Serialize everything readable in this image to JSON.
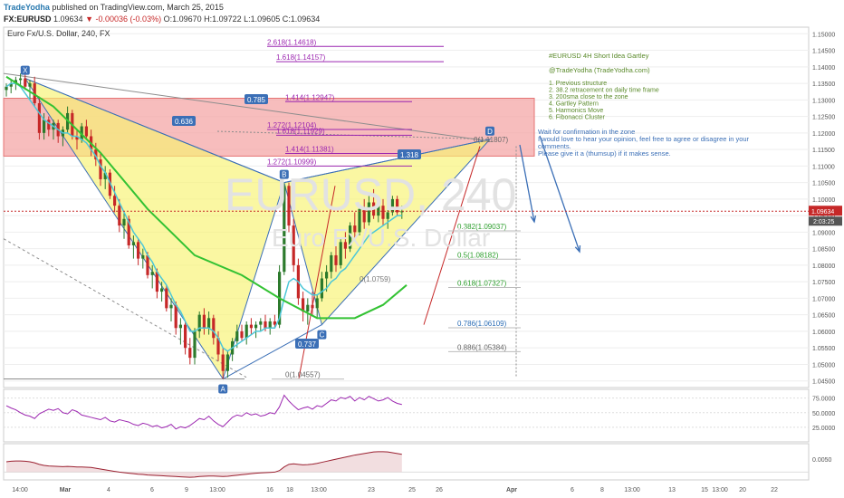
{
  "header": {
    "author": "TradeYodha",
    "published": "published on TradingView.com, March 25, 2015",
    "symbol": "FX:EURUSD",
    "last": "1.09634",
    "change": "-0.00036 (-0.03%)",
    "ohlc": "O:1.09670 H:1.09722 L:1.09605 C:1.09634"
  },
  "instrument_title": "Euro Fx/U.S. Dollar, 240, FX",
  "watermark": {
    "symbol": "EURUSD, 240",
    "name": "Euro Fx/U.S. Dollar"
  },
  "notes": {
    "title": "#EURUSD 4H Short Idea Gartley",
    "handle": "@TradeYodha (TradeYodha.com)",
    "list": [
      "1. Previous structure",
      "2. 38.2 retracement on daily time frame",
      "3. 200sma close to the zone",
      "4. Gartley Pattern",
      "5. Harmonics Move",
      "6. Fibonacci Cluster"
    ],
    "confirm": [
      "Wait for confirmation in the zone",
      "I would love to hear your opinion, feel free to agree or disagree in your",
      "comments.",
      "Please give it a (thumsup) if it makes sense."
    ]
  },
  "colors": {
    "up": "#2c7a2c",
    "down": "#c62828",
    "zone": "#f4a7a7",
    "pattern": "#f8f270",
    "ema": "#4cc7d8",
    "sma": "#33c233",
    "osc1": "#9c27b0",
    "osc2": "#9a2030",
    "arrow": "#3b6fb6",
    "label_bg": "#3b6fb6"
  },
  "chart_data": [
    {
      "type": "candlestick",
      "title": "Euro Fx/U.S. Dollar, 240, FX",
      "x_ticks": [
        "14:00",
        "Mar",
        "4",
        "6",
        "9",
        "13:00",
        "16",
        "18",
        "13:00",
        "23",
        "25",
        "26",
        "Apr",
        "6",
        "8",
        "13:00",
        "13",
        "15",
        "13:00",
        "20",
        "22"
      ],
      "y_ticks": [
        "1.04500",
        "1.05000",
        "1.05500",
        "1.06000",
        "1.06500",
        "1.07000",
        "1.07500",
        "1.08000",
        "1.08500",
        "1.09000",
        "1.09500",
        "1.10000",
        "1.10500",
        "1.11000",
        "1.11500",
        "1.12000",
        "1.12500",
        "1.13000",
        "1.13500",
        "1.14000",
        "1.14500",
        "1.15000"
      ],
      "ylim": [
        1.043,
        1.152
      ],
      "last_price_label": "1.09634",
      "countdown_label": "2:03:25",
      "ohlc": [
        [
          1.133,
          1.135,
          1.131,
          1.134
        ],
        [
          1.134,
          1.136,
          1.132,
          1.135
        ],
        [
          1.135,
          1.137,
          1.133,
          1.136
        ],
        [
          1.136,
          1.138,
          1.134,
          1.1365
        ],
        [
          1.1365,
          1.138,
          1.133,
          1.134
        ],
        [
          1.134,
          1.136,
          1.13,
          1.135
        ],
        [
          1.135,
          1.137,
          1.128,
          1.129
        ],
        [
          1.129,
          1.131,
          1.118,
          1.12
        ],
        [
          1.12,
          1.126,
          1.118,
          1.124
        ],
        [
          1.124,
          1.125,
          1.119,
          1.121
        ],
        [
          1.121,
          1.124,
          1.118,
          1.123
        ],
        [
          1.123,
          1.124,
          1.117,
          1.119
        ],
        [
          1.119,
          1.122,
          1.116,
          1.121
        ],
        [
          1.121,
          1.128,
          1.12,
          1.126
        ],
        [
          1.126,
          1.127,
          1.118,
          1.119
        ],
        [
          1.119,
          1.121,
          1.115,
          1.118
        ],
        [
          1.118,
          1.123,
          1.117,
          1.122
        ],
        [
          1.122,
          1.124,
          1.118,
          1.119
        ],
        [
          1.119,
          1.121,
          1.113,
          1.115
        ],
        [
          1.115,
          1.117,
          1.11,
          1.112
        ],
        [
          1.112,
          1.114,
          1.104,
          1.106
        ],
        [
          1.106,
          1.11,
          1.103,
          1.108
        ],
        [
          1.108,
          1.109,
          1.1,
          1.101
        ],
        [
          1.101,
          1.104,
          1.096,
          1.098
        ],
        [
          1.098,
          1.1,
          1.09,
          1.092
        ],
        [
          1.092,
          1.096,
          1.088,
          1.094
        ],
        [
          1.094,
          1.095,
          1.085,
          1.086
        ],
        [
          1.086,
          1.089,
          1.082,
          1.087
        ],
        [
          1.087,
          1.088,
          1.08,
          1.082
        ],
        [
          1.082,
          1.085,
          1.079,
          1.083
        ],
        [
          1.083,
          1.084,
          1.076,
          1.077
        ],
        [
          1.077,
          1.08,
          1.073,
          1.078
        ],
        [
          1.078,
          1.079,
          1.07,
          1.072
        ],
        [
          1.072,
          1.075,
          1.069,
          1.073
        ],
        [
          1.073,
          1.074,
          1.066,
          1.067
        ],
        [
          1.067,
          1.07,
          1.063,
          1.068
        ],
        [
          1.068,
          1.069,
          1.059,
          1.061
        ],
        [
          1.061,
          1.064,
          1.056,
          1.062
        ],
        [
          1.062,
          1.063,
          1.053,
          1.055
        ],
        [
          1.055,
          1.058,
          1.05,
          1.052
        ],
        [
          1.052,
          1.061,
          1.05,
          1.06
        ],
        [
          1.06,
          1.066,
          1.058,
          1.065
        ],
        [
          1.065,
          1.067,
          1.059,
          1.061
        ],
        [
          1.061,
          1.066,
          1.059,
          1.064
        ],
        [
          1.064,
          1.065,
          1.056,
          1.058
        ],
        [
          1.058,
          1.06,
          1.051,
          1.053
        ],
        [
          1.053,
          1.055,
          1.0456,
          1.048
        ],
        [
          1.048,
          1.054,
          1.046,
          1.053
        ],
        [
          1.053,
          1.058,
          1.051,
          1.057
        ],
        [
          1.057,
          1.062,
          1.055,
          1.06
        ],
        [
          1.06,
          1.062,
          1.057,
          1.058
        ],
        [
          1.058,
          1.063,
          1.056,
          1.062
        ],
        [
          1.062,
          1.064,
          1.059,
          1.061
        ],
        [
          1.061,
          1.063,
          1.058,
          1.062
        ],
        [
          1.062,
          1.064,
          1.06,
          1.063
        ],
        [
          1.063,
          1.065,
          1.06,
          1.061
        ],
        [
          1.061,
          1.064,
          1.059,
          1.063
        ],
        [
          1.063,
          1.065,
          1.061,
          1.062
        ],
        [
          1.062,
          1.08,
          1.061,
          1.078
        ],
        [
          1.078,
          1.105,
          1.077,
          1.104
        ],
        [
          1.104,
          1.105,
          1.09,
          1.092
        ],
        [
          1.092,
          1.094,
          1.078,
          1.08
        ],
        [
          1.08,
          1.082,
          1.068,
          1.07
        ],
        [
          1.07,
          1.072,
          1.063,
          1.066
        ],
        [
          1.066,
          1.07,
          1.062,
          1.068
        ],
        [
          1.068,
          1.072,
          1.065,
          1.067
        ],
        [
          1.067,
          1.071,
          1.064,
          1.07
        ],
        [
          1.07,
          1.078,
          1.069,
          1.076
        ],
        [
          1.076,
          1.08,
          1.072,
          1.078
        ],
        [
          1.078,
          1.084,
          1.076,
          1.083
        ],
        [
          1.083,
          1.086,
          1.078,
          1.08
        ],
        [
          1.08,
          1.088,
          1.079,
          1.087
        ],
        [
          1.087,
          1.09,
          1.082,
          1.085
        ],
        [
          1.085,
          1.093,
          1.084,
          1.092
        ],
        [
          1.092,
          1.096,
          1.088,
          1.09
        ],
        [
          1.09,
          1.098,
          1.089,
          1.097
        ],
        [
          1.097,
          1.1,
          1.091,
          1.093
        ],
        [
          1.093,
          1.101,
          1.092,
          1.099
        ],
        [
          1.099,
          1.103,
          1.094,
          1.095
        ],
        [
          1.095,
          1.099,
          1.093,
          1.098
        ],
        [
          1.098,
          1.1,
          1.092,
          1.094
        ],
        [
          1.094,
          1.097,
          1.091,
          1.096
        ],
        [
          1.096,
          1.101,
          1.095,
          1.1
        ],
        [
          1.1,
          1.101,
          1.095,
          1.096
        ],
        [
          1.096,
          1.098,
          1.094,
          1.0963
        ]
      ],
      "ema": [
        1.134,
        1.135,
        1.135,
        1.134,
        1.132,
        1.13,
        1.128,
        1.126,
        1.124,
        1.123,
        1.122,
        1.121,
        1.12,
        1.12,
        1.119,
        1.119,
        1.118,
        1.117,
        1.115,
        1.113,
        1.11,
        1.108,
        1.105,
        1.102,
        1.099,
        1.096,
        1.093,
        1.09,
        1.088,
        1.086,
        1.083,
        1.081,
        1.078,
        1.076,
        1.074,
        1.071,
        1.068,
        1.066,
        1.063,
        1.06,
        1.06,
        1.061,
        1.061,
        1.061,
        1.06,
        1.058,
        1.055,
        1.054,
        1.055,
        1.056,
        1.057,
        1.058,
        1.059,
        1.06,
        1.06,
        1.061,
        1.061,
        1.061,
        1.064,
        1.07,
        1.075,
        1.076,
        1.075,
        1.073,
        1.072,
        1.071,
        1.071,
        1.072,
        1.073,
        1.075,
        1.076,
        1.078,
        1.079,
        1.081,
        1.083,
        1.085,
        1.087,
        1.089,
        1.09,
        1.091,
        1.092,
        1.093,
        1.094,
        1.095,
        1.095
      ],
      "sma": [
        [
          0,
          1.137
        ],
        [
          10,
          1.128
        ],
        [
          20,
          1.114
        ],
        [
          30,
          1.097
        ],
        [
          40,
          1.083
        ],
        [
          50,
          1.077
        ],
        [
          58,
          1.07
        ],
        [
          66,
          1.064
        ],
        [
          74,
          1.064
        ],
        [
          80,
          1.068
        ],
        [
          85,
          1.074
        ]
      ],
      "gartley_points": [
        {
          "label": "X",
          "price": 1.1365
        },
        {
          "label": "A",
          "price": 1.0456
        },
        {
          "label": "B",
          "price": 1.105
        },
        {
          "label": "C",
          "price": 1.062
        },
        {
          "label": "D",
          "price": 1.1181
        }
      ],
      "pattern_ratios": [
        "0.636",
        "0.785",
        "0.737",
        "1.318"
      ],
      "zone": [
        1.113,
        1.1305
      ],
      "fib_ext": [
        {
          "label": "2.618(1.14618)",
          "price": 1.14618
        },
        {
          "label": "1.618(1.14157)",
          "price": 1.14157
        },
        {
          "label": "1.414(1.12947)",
          "price": 1.12947
        },
        {
          "label": "1.272(1.12104)",
          "price": 1.12104
        },
        {
          "label": "1.618(1.11929)",
          "price": 1.11929
        },
        {
          "label": "1.414(1.11381)",
          "price": 1.11381
        },
        {
          "label": "1.272(1.10999)",
          "price": 1.10999
        }
      ],
      "fib_ret": [
        {
          "label": "0.382(1.09037)",
          "price": 1.09037
        },
        {
          "label": "0.5(1.08182)",
          "price": 1.08182
        },
        {
          "label": "0.618(1.07327)",
          "price": 1.07327
        },
        {
          "label": "0.786(1.06109)",
          "price": 1.06109
        },
        {
          "label": "0.886(1.05384)",
          "price": 1.05384
        },
        {
          "label": "0(1.04557)",
          "price": 1.04557
        }
      ],
      "d_level_label": "0(1.11807)",
      "c_level_label": "0(1.0759)"
    },
    {
      "type": "line",
      "panel": "oscillator-1",
      "y_ticks": [
        "25.0000",
        "50.0000",
        "75.0000"
      ],
      "ylim": [
        0,
        90
      ],
      "values": [
        62,
        58,
        55,
        50,
        46,
        44,
        40,
        48,
        52,
        56,
        54,
        57,
        50,
        48,
        55,
        52,
        46,
        44,
        42,
        40,
        38,
        42,
        36,
        34,
        38,
        36,
        34,
        30,
        28,
        32,
        30,
        26,
        28,
        24,
        26,
        30,
        22,
        26,
        24,
        28,
        34,
        40,
        38,
        44,
        36,
        30,
        26,
        34,
        42,
        46,
        44,
        50,
        46,
        48,
        44,
        46,
        50,
        48,
        60,
        80,
        70,
        62,
        55,
        58,
        60,
        56,
        62,
        60,
        66,
        72,
        70,
        76,
        74,
        78,
        70,
        76,
        72,
        78,
        74,
        70,
        72,
        76,
        70,
        66,
        64
      ]
    },
    {
      "type": "area",
      "panel": "oscillator-2",
      "y_ticks": [
        "0.0050"
      ],
      "ylim": [
        -0.003,
        0.011
      ],
      "values": [
        0.004,
        0.0042,
        0.0043,
        0.0043,
        0.0042,
        0.004,
        0.0036,
        0.003,
        0.0026,
        0.0024,
        0.0023,
        0.0022,
        0.0021,
        0.0022,
        0.0021,
        0.002,
        0.002,
        0.0019,
        0.0018,
        0.0015,
        0.0012,
        0.0009,
        0.0006,
        0.0003,
        0.0,
        -0.0002,
        -0.0004,
        -0.0006,
        -0.0008,
        -0.0009,
        -0.0011,
        -0.0012,
        -0.0013,
        -0.0014,
        -0.0015,
        -0.0016,
        -0.0017,
        -0.0018,
        -0.0019,
        -0.002,
        -0.0019,
        -0.0017,
        -0.0016,
        -0.0015,
        -0.0015,
        -0.0016,
        -0.0017,
        -0.0016,
        -0.0014,
        -0.0012,
        -0.001,
        -0.0008,
        -0.0006,
        -0.0004,
        -0.0003,
        -0.0002,
        -0.0001,
        0.0,
        0.0006,
        0.002,
        0.003,
        0.0032,
        0.003,
        0.0028,
        0.0029,
        0.0031,
        0.0034,
        0.0038,
        0.0042,
        0.0046,
        0.005,
        0.0054,
        0.0058,
        0.0062,
        0.0066,
        0.0069,
        0.0072,
        0.0075,
        0.0078,
        0.0079,
        0.0079,
        0.0078,
        0.0075,
        0.0072,
        0.0069
      ]
    }
  ]
}
